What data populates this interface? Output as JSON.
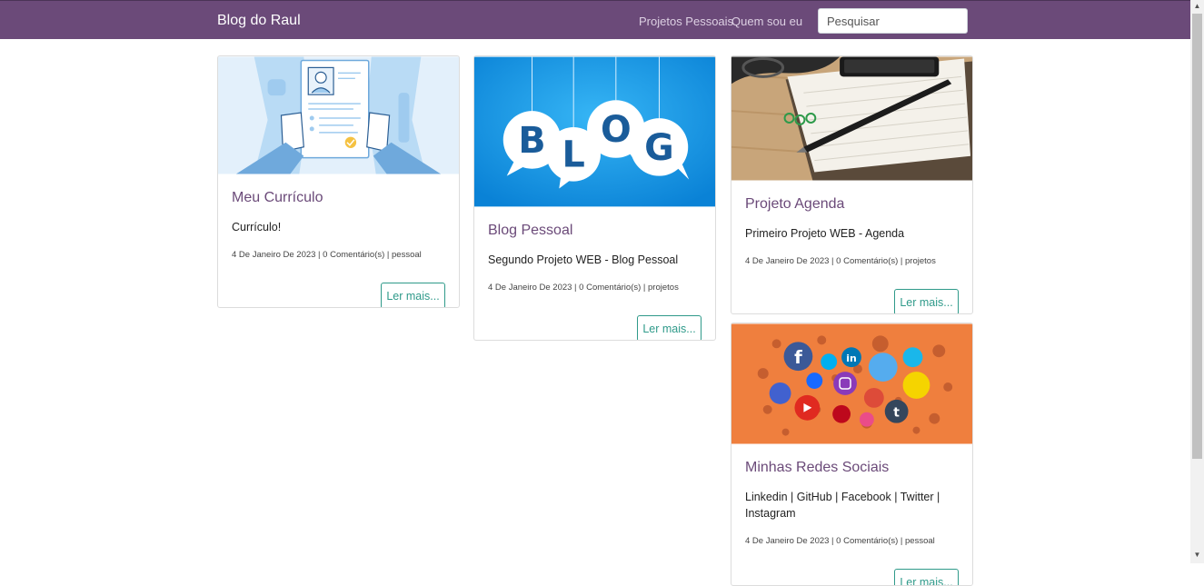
{
  "navbar": {
    "brand": "Blog do Raul",
    "links": [
      "Projetos Pessoais",
      "Quem sou eu"
    ],
    "search_placeholder": "Pesquisar",
    "bg_color": "#6b4a79"
  },
  "cards": [
    {
      "title": "Meu Currículo",
      "text": "Currículo!",
      "meta": "4 De Janeiro De 2023 | 0 Comentário(s) | pessoal",
      "button": "Ler mais..."
    },
    {
      "title": "Blog Pessoal",
      "text": "Segundo Projeto WEB - Blog Pessoal",
      "meta": "4 De Janeiro De 2023 | 0 Comentário(s) | projetos",
      "button": "Ler mais...",
      "image_text": [
        "B",
        "L",
        "O",
        "G"
      ]
    },
    {
      "title": "Projeto Agenda",
      "text": "Primeiro Projeto WEB - Agenda",
      "meta": "4 De Janeiro De 2023 | 0 Comentário(s) | projetos",
      "button": "Ler mais..."
    },
    {
      "title": "Minhas Redes Sociais",
      "text": "Linkedin | GitHub | Facebook | Twitter | Instagram",
      "meta": "4 De Janeiro De 2023 | 0 Comentário(s) | pessoal",
      "button": "Ler mais..."
    }
  ],
  "colors": {
    "accent": "#2f9a8a",
    "title": "#6b4a79"
  }
}
